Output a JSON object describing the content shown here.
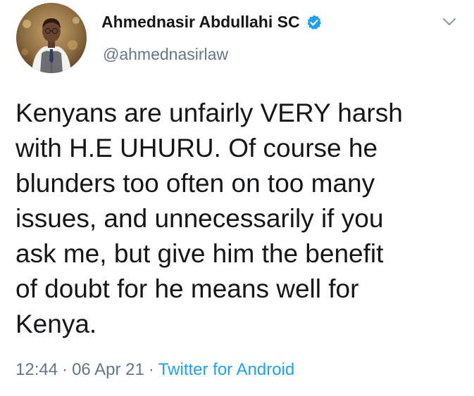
{
  "author": {
    "name": "Ahmednasir Abdullahi SC",
    "handle": "@ahmednasirlaw",
    "verified": true
  },
  "tweet": {
    "lines": [
      "Kenyans are unfairly VERY harsh",
      "with H.E UHURU. Of course he",
      "blunders too often on too many",
      "issues, and unnecessarily if you",
      "ask me, but give him the benefit",
      "of doubt for he means well for",
      "Kenya."
    ]
  },
  "meta": {
    "time": "12:44",
    "date": "06 Apr 21",
    "separator": "·",
    "source": "Twitter for Android"
  },
  "colors": {
    "text": "#14171a",
    "secondary": "#657786",
    "link": "#1da1f2",
    "verified_badge": "#1da1f2"
  },
  "icons": {
    "verified": "verified-badge-icon",
    "menu": "chevron-down-icon"
  }
}
